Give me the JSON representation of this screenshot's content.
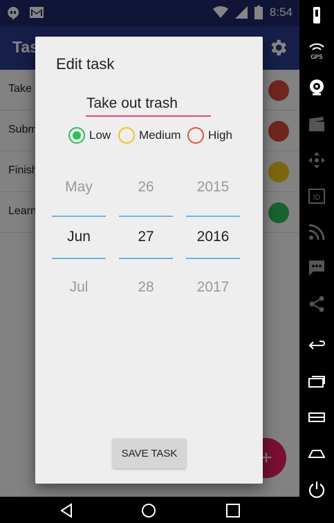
{
  "statusbar": {
    "time": "8:54"
  },
  "appbar": {
    "title": "Tasks"
  },
  "tasks": [
    {
      "label": "Take out trash",
      "color": "#d64a3a"
    },
    {
      "label": "Submit report",
      "color": "#d64a3a"
    },
    {
      "label": "Finish homework",
      "color": "#f2c21d"
    },
    {
      "label": "Learn Android",
      "color": "#2ebd59"
    }
  ],
  "fab": {
    "label": "+"
  },
  "dialog": {
    "title": "Edit task",
    "task_value": "Take out trash",
    "priorities": [
      {
        "label": "Low",
        "color": "#2ebd59",
        "checked": true
      },
      {
        "label": "Medium",
        "color": "#f2c21d",
        "checked": false
      },
      {
        "label": "High",
        "color": "#e0533f",
        "checked": false
      }
    ],
    "date_picker": {
      "month": {
        "prev": "May",
        "selected": "Jun",
        "next": "Jul"
      },
      "day": {
        "prev": "26",
        "selected": "27",
        "next": "28"
      },
      "year": {
        "prev": "2015",
        "selected": "2016",
        "next": "2017"
      }
    },
    "save_label": "SAVE TASK"
  },
  "sidebar": {
    "gps_label": "GPS"
  }
}
